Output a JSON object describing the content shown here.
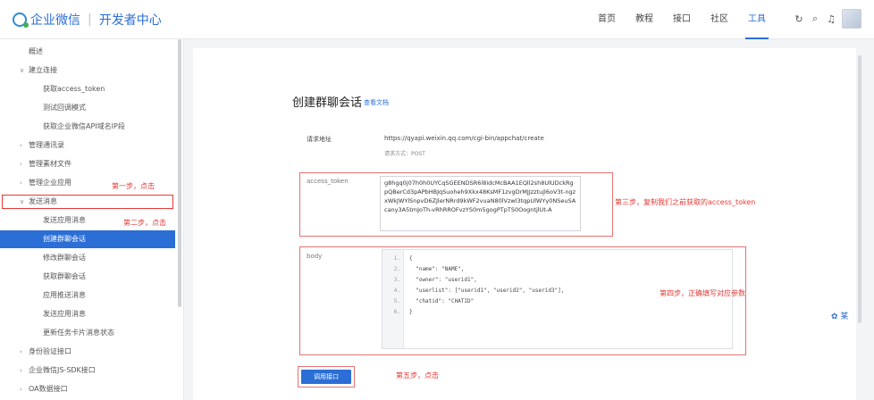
{
  "header": {
    "logo_text": "企业微信",
    "logo_sub": "开发者中心",
    "nav": [
      "首页",
      "教程",
      "接口",
      "社区",
      "工具"
    ],
    "active_nav": "工具"
  },
  "sidebar": {
    "items": [
      {
        "label": "概述",
        "level": "l1",
        "caret": ""
      },
      {
        "label": "建立连接",
        "level": "l1",
        "caret": "∨"
      },
      {
        "label": "获取access_token",
        "level": "l2",
        "caret": ""
      },
      {
        "label": "测试回调模式",
        "level": "l2",
        "caret": ""
      },
      {
        "label": "获取企业微信API域名IP段",
        "level": "l2",
        "caret": ""
      },
      {
        "label": "管理通讯录",
        "level": "l1",
        "caret": "›"
      },
      {
        "label": "管理素材文件",
        "level": "l1",
        "caret": "›"
      },
      {
        "label": "管理企业应用",
        "level": "l1",
        "caret": "›"
      },
      {
        "label": "发送消息",
        "level": "l1",
        "caret": "∨"
      },
      {
        "label": "发送应用消息",
        "level": "l2",
        "caret": ""
      },
      {
        "label": "创建群聊会话",
        "level": "l2",
        "caret": ""
      },
      {
        "label": "修改群聊会话",
        "level": "l2",
        "caret": ""
      },
      {
        "label": "获取群聊会话",
        "level": "l2",
        "caret": ""
      },
      {
        "label": "应用推送消息",
        "level": "l2",
        "caret": ""
      },
      {
        "label": "发送应用消息",
        "level": "l2",
        "caret": ""
      },
      {
        "label": "更新任务卡片消息状态",
        "level": "l2",
        "caret": ""
      },
      {
        "label": "身份验证接口",
        "level": "l1",
        "caret": "›"
      },
      {
        "label": "企业微信JS-SDK接口",
        "level": "l1",
        "caret": "›"
      },
      {
        "label": "OA数据接口",
        "level": "l1",
        "caret": "›"
      }
    ],
    "active_index": 10,
    "boxed_index": 8,
    "annotations": {
      "step1": "第一步，点击",
      "step2": "第二步，点击"
    }
  },
  "main": {
    "title": "创建群聊会话",
    "doc_link": "查看文档",
    "request_url_label": "请求地址",
    "request_url": "https://qyapi.weixin.qq.com/cgi-bin/appchat/create",
    "request_method": "请求方式：POST",
    "access_token_label": "access_token",
    "access_token_value": "g8hgq0j07h0h0UYCqSGEENDSR6l8idcMcBAA1EQll2sh8UlUDckRgpQBerCd3pAPbHBJqSuoheh9Xkx48KsMF1zvgDrMJJzztujl6oV3t-ngzxWkJWYlSnpvD6ZJlerNRrd9kWF2vuaN80lVzwl3tqpUlWYy0NSeuSAcany3A5tmJoTh-vRhRROFvzYS0m5gogPTpTS0OogntjlUt-A",
    "step3": "第三步，复制我们之前获取的access_token",
    "body_label": "body",
    "code_lines": [
      {
        "num": "1.",
        "text": "{"
      },
      {
        "num": "2.",
        "text": "  \"name\": \"NAME\","
      },
      {
        "num": "3.",
        "text": "  \"owner\": \"userid1\","
      },
      {
        "num": "4.",
        "text": "  \"userlist\": [\"userid1\", \"userid2\", \"userid3\"],"
      },
      {
        "num": "5.",
        "text": "  \"chatid\": \"CHATID\""
      },
      {
        "num": "6.",
        "text": "}"
      }
    ],
    "step4": "第四步，正确填写对应参数",
    "button_label": "调用接口",
    "step5": "第五步，点击"
  },
  "float_tool": "✿ 某"
}
